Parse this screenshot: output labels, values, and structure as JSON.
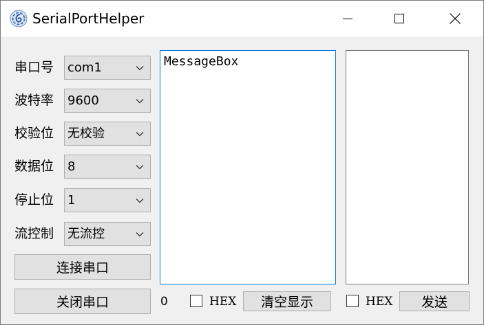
{
  "window": {
    "title": "SerialPortHelper"
  },
  "settings": [
    {
      "label": "串口号",
      "value": "com1"
    },
    {
      "label": "波特率",
      "value": "9600"
    },
    {
      "label": "校验位",
      "value": "无校验"
    },
    {
      "label": "数据位",
      "value": "8"
    },
    {
      "label": "停止位",
      "value": "1"
    },
    {
      "label": "流控制",
      "value": "无流控"
    }
  ],
  "buttons": {
    "connect": "连接串口",
    "close": "关闭串口",
    "clear": "清空显示",
    "send": "发送"
  },
  "receive": {
    "text": "MessageBox",
    "count": "0",
    "hex_label": "HEX",
    "hex_checked": false
  },
  "send_area": {
    "text": "",
    "hex_label": "HEX",
    "hex_checked": false
  },
  "colors": {
    "focus_border": "#0078d7",
    "button_bg": "#e1e1e1",
    "window_bg": "#f0f0f0"
  }
}
